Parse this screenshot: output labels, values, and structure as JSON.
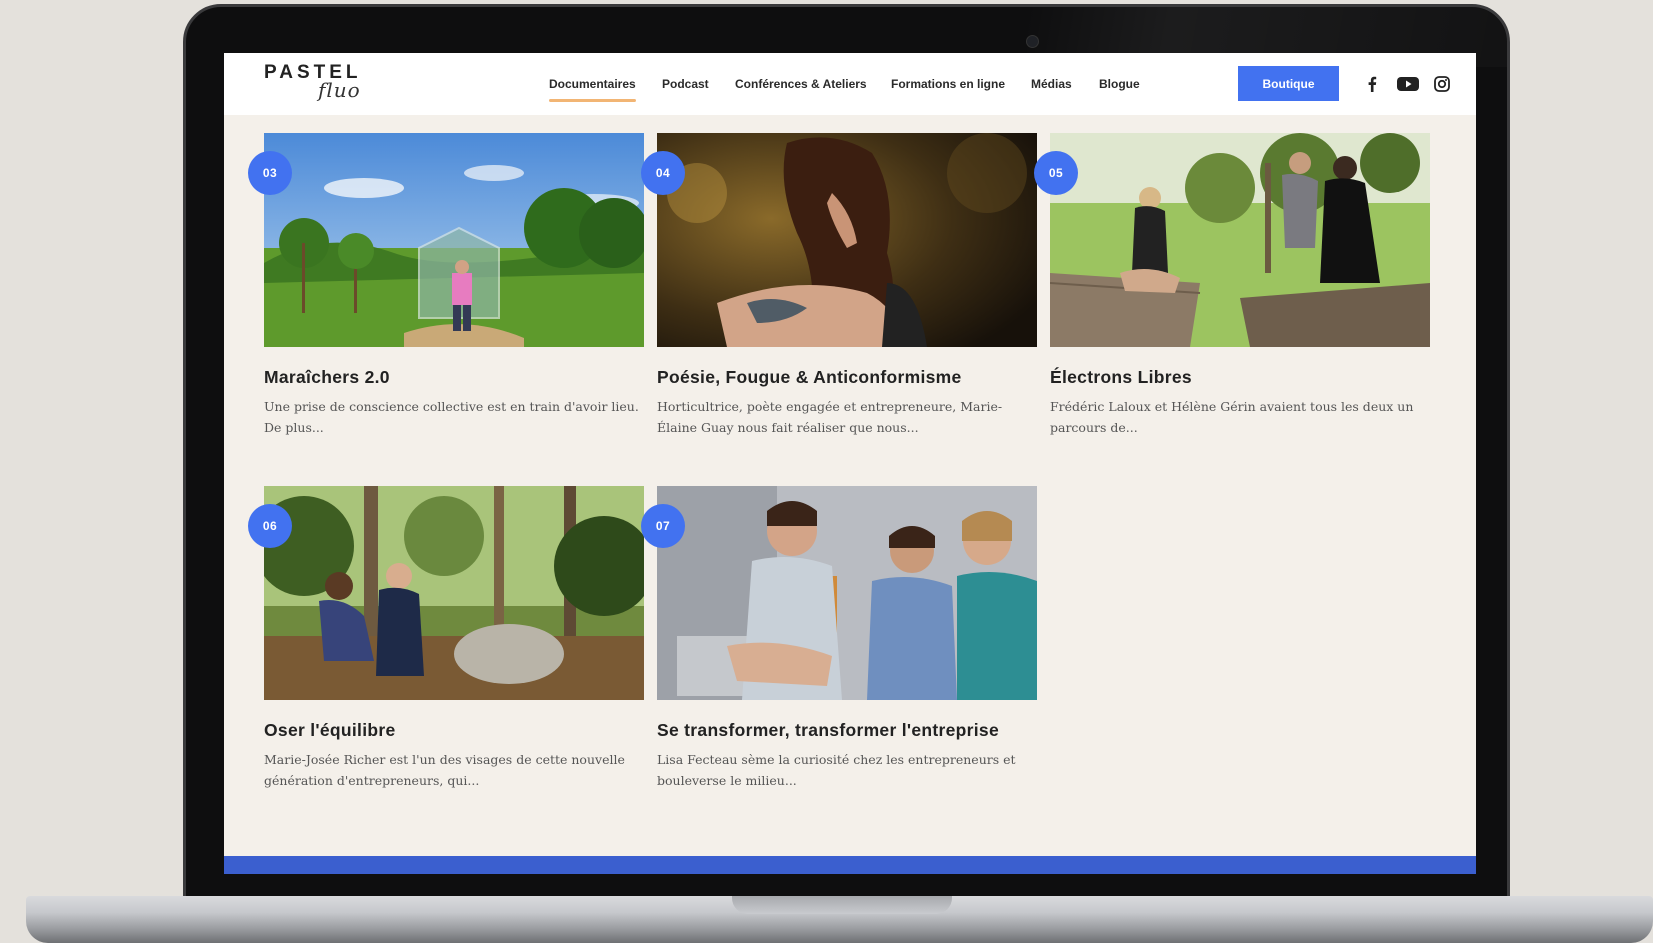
{
  "header": {
    "logo_main": "PASTEL",
    "logo_script": "fluo",
    "nav": [
      {
        "label": "Documentaires",
        "active": true
      },
      {
        "label": "Podcast",
        "active": false
      },
      {
        "label": "Conférences & Ateliers",
        "active": false
      },
      {
        "label": "Formations en ligne",
        "active": false
      },
      {
        "label": "Médias",
        "active": false
      },
      {
        "label": "Blogue",
        "active": false
      }
    ],
    "shop_label": "Boutique",
    "social": [
      "facebook-icon",
      "youtube-icon",
      "instagram-icon"
    ]
  },
  "colors": {
    "accent": "#4272f0",
    "nav_underline": "#f2b574",
    "page_bg": "#f4f0ea",
    "footer": "#3b5fcf"
  },
  "cards": [
    {
      "number": "03",
      "title": "Maraîchers 2.0",
      "desc": "Une prise de conscience collective est en train d'avoir lieu. De plus..."
    },
    {
      "number": "04",
      "title": "Poésie, Fougue & Anticonformisme",
      "desc": "Horticultrice, poète engagée et entrepreneure, Marie-Élaine Guay nous fait réaliser que nous..."
    },
    {
      "number": "05",
      "title": "Électrons Libres",
      "desc": "Frédéric Laloux et Hélène Gérin avaient tous les deux un parcours de..."
    },
    {
      "number": "06",
      "title": "Oser l'équilibre",
      "desc": "Marie-Josée Richer est l'un des visages de cette nouvelle génération d'entrepreneurs, qui..."
    },
    {
      "number": "07",
      "title": "Se transformer, transformer l'entreprise",
      "desc": "Lisa Fecteau sème la curiosité chez les entrepreneurs et bouleverse le milieu..."
    }
  ]
}
